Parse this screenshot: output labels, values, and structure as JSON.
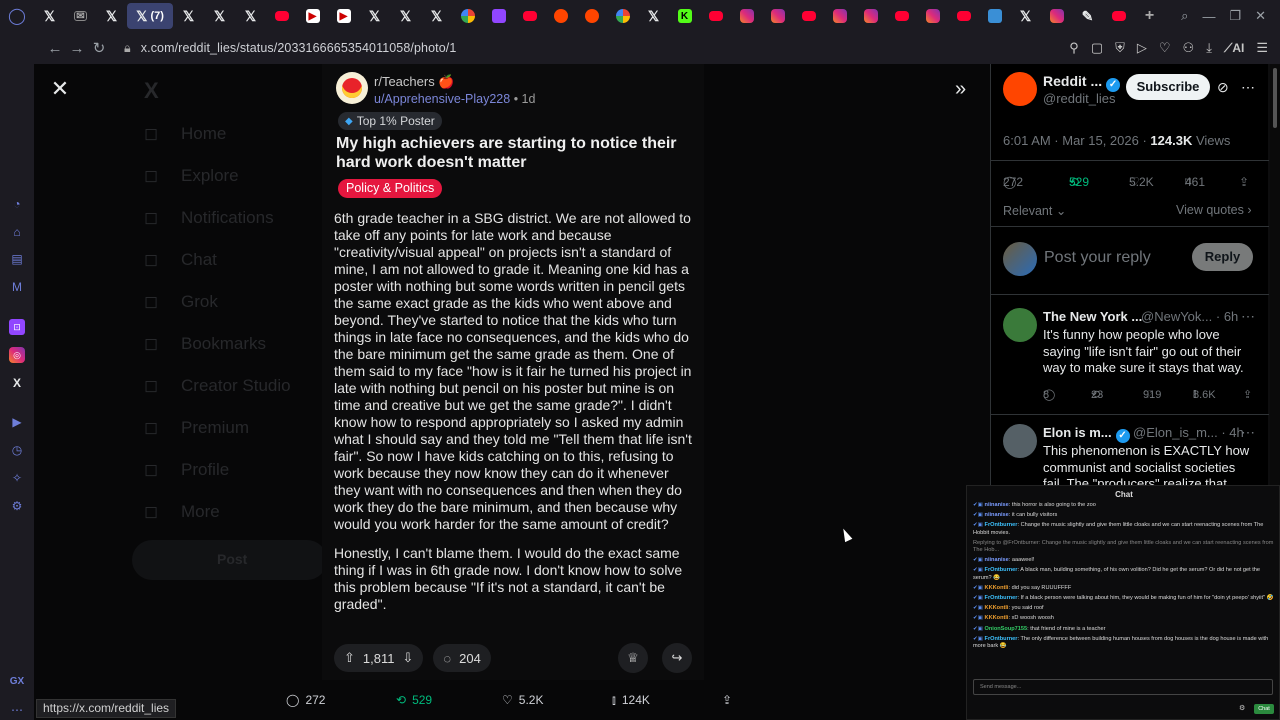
{
  "tabbar": {
    "active_tab_label": "(7)",
    "tabs": [
      "x-icon",
      "mail-icon",
      "x-icon",
      "x-active",
      "x-icon",
      "x-icon",
      "x-icon",
      "youtube-icon",
      "bookmark-icon",
      "bookmark-icon",
      "x-icon",
      "x-icon",
      "x-icon",
      "google-icon",
      "twitch-icon",
      "youtube-icon",
      "reddit-icon",
      "reddit-icon",
      "google-icon",
      "x-icon",
      "kick-icon",
      "youtube-icon",
      "instagram-icon",
      "instagram-icon",
      "youtube-icon",
      "instagram-icon",
      "instagram-icon",
      "youtube-icon",
      "instagram-icon",
      "youtube-icon",
      "map-icon",
      "x-icon",
      "instagram-icon",
      "pen-icon",
      "youtube-icon"
    ],
    "new_tab": "+"
  },
  "address": {
    "url": "x.com/reddit_lies/status/2033166665354011058/photo/1",
    "ai_label": "AI"
  },
  "post": {
    "subreddit": "r/Teachers",
    "subreddit_emoji": "🍎",
    "user": "u/Apprehensive-Play228",
    "age": "1d",
    "badge": "Top 1% Poster",
    "title": "My high achievers are starting to notice their hard work doesn't matter",
    "flair": "Policy & Politics",
    "body1": "6th grade teacher in a SBG district. We are not allowed to take off any points for late work and because \"creativity/visual appeal\" on projects isn't a standard of mine, I am not allowed to grade it. Meaning one kid has a poster with nothing but some words written in pencil gets the same exact grade as the kids who went above and beyond. They've started to notice that the kids who turn things in late face no consequences, and the kids who do the bare minimum get the same grade as them. One of them said to my face \"how is it fair he turned his project in late with nothing but pencil on his poster but mine is on time and creative but we get the same grade?\". I didn't know how to respond appropriately so I asked my admin what I should say and they told me \"Tell them that life isn't fair\". So now I have kids catching on to this, refusing to work because they now know they can do it whenever they want with no consequences and then when they do work they do the bare minimum, and then because why would you work harder for the same amount of credit?",
    "body2": "Honestly, I can't blame them. I would do the exact same thing if I was in 6th grade now. I don't know how to solve this problem because \"If it's not a standard, it can't be graded\".",
    "upvotes": "1,811",
    "comments": "204"
  },
  "media_bar": {
    "replies": "272",
    "reposts": "529",
    "likes": "5.2K",
    "views": "124K"
  },
  "status_url": "https://x.com/reddit_lies",
  "ghost_nav": [
    "Home",
    "Explore",
    "Notifications",
    "Chat",
    "Grok",
    "Bookmarks",
    "Creator Studio",
    "Premium",
    "Profile",
    "More"
  ],
  "ghost_post_button": "Post",
  "right_panel": {
    "author_name": "Reddit ...",
    "author_handle": "@reddit_lies",
    "subscribe": "Subscribe",
    "time": "6:01 AM · Mar 15, 2026 ·",
    "views_count": "124.3K",
    "views_label": "Views",
    "replies": "272",
    "reposts": "529",
    "likes": "5.2K",
    "bookmarks": "461",
    "sort": "Relevant",
    "view_quotes": "View quotes",
    "reply_placeholder": "Post your reply",
    "reply_button": "Reply",
    "replies_list": [
      {
        "name": "The New York ...",
        "handle": "@NewYok...",
        "age": "· 6h",
        "text": "It's funny how people who love saying \"life isn't fair\" go out of their way to make sure it stays that way.",
        "replies": "8",
        "reposts": "23",
        "likes": "919",
        "views": "8.6K"
      },
      {
        "name": "Elon is m...",
        "handle": "@Elon_is_m...",
        "age": "· 4h",
        "text": "This phenomenon is EXACTLY how communist and socialist societies fail. The \"producers\" realize that they"
      }
    ]
  },
  "chat": {
    "title": "Chat",
    "messages": [
      {
        "user": "niinanise",
        "cls": "u1",
        "text": "this horror is also going to the zoo"
      },
      {
        "user": "niinanise",
        "cls": "u1",
        "text": "it can bully visitors"
      },
      {
        "user": "FrOntburner",
        "cls": "u3",
        "text": "Change the music slightly and give them little cloaks and we can start reenacting scenes from The Hobbit movies."
      },
      {
        "user": "",
        "cls": "sys",
        "text": "Replying to @FrOntburner: Change the music slightly and give them little cloaks and we can start reenacting scenes from The Hob..."
      },
      {
        "user": "niinanise",
        "cls": "u1",
        "text": "aaaweel!"
      },
      {
        "user": "FrOntburner",
        "cls": "u3",
        "text": "A black man, building something, of his own volition? Did he get the serum? Or did he not get the serum? 😂"
      },
      {
        "user": "KKKontli",
        "cls": "u2",
        "text": "did you say RUUUFFFF"
      },
      {
        "user": "FrOntburner",
        "cls": "u3",
        "text": "If a black person were talking about him, they would be making fun of him for \"doin yt peepo' shyiit\" 🤣"
      },
      {
        "user": "KKKontli",
        "cls": "u2",
        "text": "you said roof"
      },
      {
        "user": "KKKontli",
        "cls": "u2",
        "text": "xD woosh woosh"
      },
      {
        "user": "OnionSoup7155",
        "cls": "u4",
        "text": "that friend of mine is a teacher"
      },
      {
        "user": "FrOntburner",
        "cls": "u3",
        "text": "The only difference between building human houses from dog houses is the dog house is made with more bark 😂"
      }
    ],
    "input_placeholder": "Send message...",
    "send": "Chat"
  }
}
